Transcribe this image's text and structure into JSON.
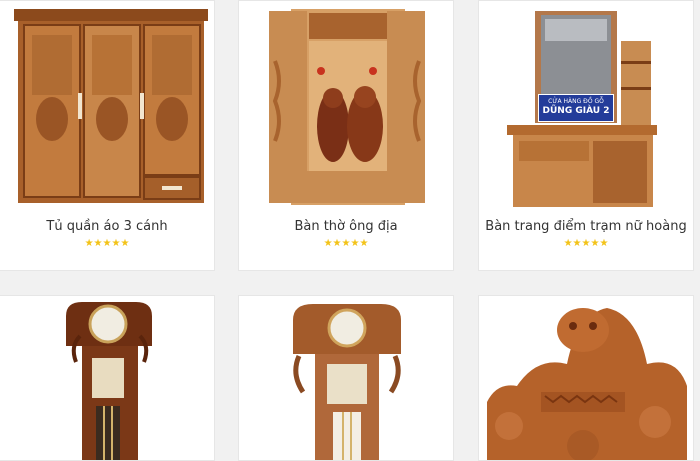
{
  "products": [
    {
      "name": "Tủ quần áo 3 cánh",
      "rating_stars": "★★★★★",
      "rating": 5,
      "image_icon": "wardrobe-image"
    },
    {
      "name": "Bàn thờ ông địa",
      "rating_stars": "★★★★★",
      "rating": 5,
      "image_icon": "altar-image"
    },
    {
      "name": "Bàn trang điểm trạm nữ hoàng",
      "rating_stars": "★★★★★",
      "rating": 5,
      "image_icon": "dressing-table-image",
      "sign_lines": [
        "CỬA HÀNG ĐỒ GỖ",
        "DŨNG GIÀU 2"
      ]
    },
    {
      "image_icon": "grandfather-clock-image"
    },
    {
      "image_icon": "carved-clock-image"
    },
    {
      "image_icon": "carved-panel-image"
    }
  ],
  "colors": {
    "star": "#f3c318",
    "wood_light": "#c8864a",
    "wood_dark": "#7a3d16",
    "card_bg": "#ffffff",
    "page_bg": "#f1f1f1"
  }
}
